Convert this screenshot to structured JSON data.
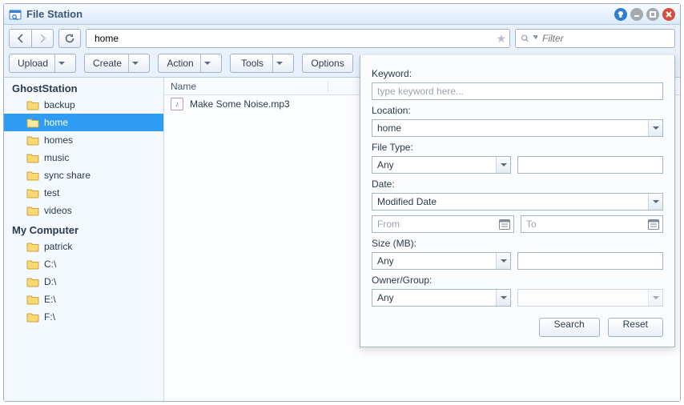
{
  "window": {
    "title": "File Station"
  },
  "nav": {
    "address": "home"
  },
  "filter": {
    "placeholder": "Filter"
  },
  "toolbar": {
    "upload": "Upload",
    "create": "Create",
    "action": "Action",
    "tools": "Tools",
    "options": "Options"
  },
  "sidebar": {
    "group1": {
      "label": "GhostStation",
      "items": [
        "backup",
        "home",
        "homes",
        "music",
        "sync share",
        "test",
        "videos"
      ],
      "selected_index": 1
    },
    "group2": {
      "label": "My Computer",
      "items": [
        "patrick",
        "C:\\",
        "D:\\",
        "E:\\",
        "F:\\"
      ]
    }
  },
  "columns": {
    "name": "Name"
  },
  "files": [
    {
      "name": "Make Some Noise.mp3",
      "kind": "audio"
    }
  ],
  "adv": {
    "keyword_label": "Keyword:",
    "keyword_placeholder": "type keyword here...",
    "location_label": "Location:",
    "location_value": "home",
    "filetype_label": "File Type:",
    "filetype_value": "Any",
    "date_label": "Date:",
    "date_value": "Modified Date",
    "from_placeholder": "From",
    "to_placeholder": "To",
    "size_label": "Size (MB):",
    "size_value": "Any",
    "owner_label": "Owner/Group:",
    "owner_value": "Any",
    "search_btn": "Search",
    "reset_btn": "Reset"
  }
}
